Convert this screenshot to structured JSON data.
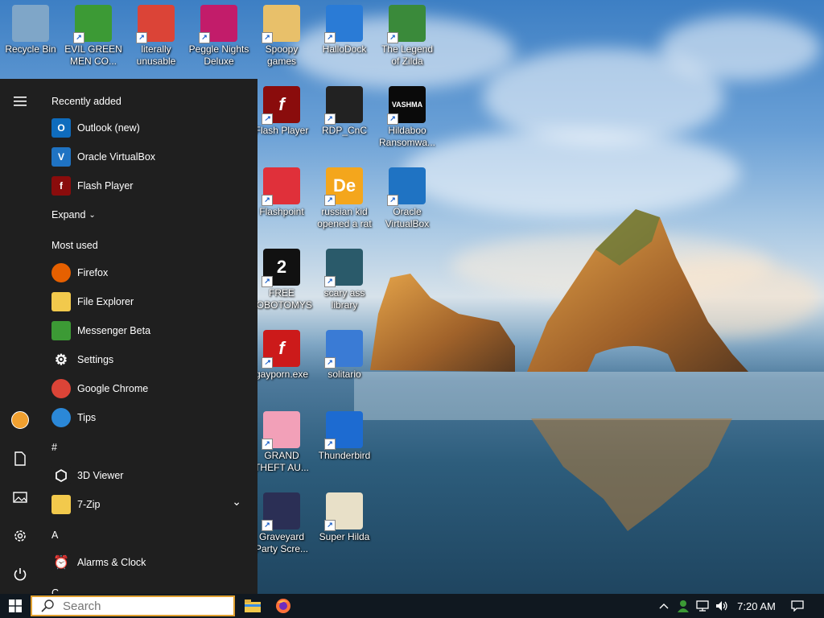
{
  "desktop": {
    "icons": [
      {
        "label": "Recycle Bin",
        "icon": "recycle-bin-icon",
        "color": "#7fa6c8"
      },
      {
        "label": "EVIL GREEN MEN CO...",
        "icon": "messenger-green-men-icon",
        "color": "#3c9a35"
      },
      {
        "label": "literally unusable",
        "icon": "chrome-icon",
        "color": "#db4437"
      },
      {
        "label": "Peggle Nights Deluxe",
        "icon": "peggle-icon",
        "color": "#c21c6a"
      },
      {
        "label": "Spoopy games",
        "icon": "folder-games-icon",
        "color": "#e8c06a"
      },
      {
        "label": "HalloDock",
        "icon": "shield-icon",
        "color": "#2a7bd6"
      },
      {
        "label": "The Legend of Zilda",
        "icon": "zilda-character-icon",
        "color": "#3a8a3a"
      },
      {
        "label": "Flash Player",
        "icon": "flash-player-icon",
        "color": "#8a0c0c",
        "glyph": "f"
      },
      {
        "label": "RDP_CnC",
        "icon": "rdp-icon",
        "color": "#222222"
      },
      {
        "label": "Hildaboo Ransomwa...",
        "icon": "vashma-icon",
        "color": "#0a0a0a",
        "glyph": "VASHMA"
      },
      {
        "label": "Flashpoint",
        "icon": "flashpoint-icon",
        "color": "#e0303a"
      },
      {
        "label": "russian kid opened a rat",
        "icon": "de-icon",
        "color": "#f4a61c",
        "glyph": "De"
      },
      {
        "label": "Oracle VirtualBox",
        "icon": "virtualbox-icon",
        "color": "#1f73c3"
      },
      {
        "label": "FREE LOBOTOMYS",
        "icon": "lobotomy-icon",
        "color": "#111111",
        "glyph": "2"
      },
      {
        "label": "scary ass library",
        "icon": "library-icon",
        "color": "#2a5a6a"
      },
      {
        "label": "gayporn.exe",
        "icon": "flash-red-icon",
        "color": "#cc1a1a",
        "glyph": "f"
      },
      {
        "label": "solitario",
        "icon": "solitario-icon",
        "color": "#3a7bd5"
      },
      {
        "label": "GRAND THEFT AU...",
        "icon": "anime-girl-icon",
        "color": "#f2a0b8"
      },
      {
        "label": "Thunderbird",
        "icon": "thunderbird-icon",
        "color": "#1d6bd1"
      },
      {
        "label": "Graveyard Party Scre...",
        "icon": "graveyard-icon",
        "color": "#2b2f55"
      },
      {
        "label": "Super Hilda",
        "icon": "super-hilda-icon",
        "color": "#e8e0c8"
      }
    ]
  },
  "start_menu": {
    "rail": {
      "hamburger_icon": "hamburger-menu-icon",
      "buttons": [
        {
          "icon": "user-avatar-icon"
        },
        {
          "icon": "documents-icon"
        },
        {
          "icon": "pictures-icon"
        },
        {
          "icon": "settings-gear-icon"
        },
        {
          "icon": "power-icon"
        }
      ]
    },
    "recently_added_header": "Recently added",
    "recently_added": [
      {
        "label": "Outlook (new)",
        "icon": "outlook-icon",
        "color": "#0f6cbd",
        "glyph": "O"
      },
      {
        "label": "Oracle VirtualBox",
        "icon": "virtualbox-icon",
        "color": "#1f73c3",
        "glyph": "V"
      },
      {
        "label": "Flash Player",
        "icon": "flash-player-icon",
        "color": "#8a0c0c",
        "glyph": "f"
      }
    ],
    "expand_label": "Expand",
    "most_used_header": "Most used",
    "most_used": [
      {
        "label": "Firefox",
        "icon": "firefox-icon",
        "color": "#e66000"
      },
      {
        "label": "File Explorer",
        "icon": "file-explorer-icon",
        "color": "#f2c94c"
      },
      {
        "label": "Messenger Beta",
        "icon": "messenger-icon",
        "color": "#3c9a35"
      },
      {
        "label": "Settings",
        "icon": "settings-gear-icon",
        "color": "#1f1f1f"
      },
      {
        "label": "Google Chrome",
        "icon": "chrome-icon",
        "color": "#db4437"
      },
      {
        "label": "Tips",
        "icon": "tips-lightbulb-icon",
        "color": "#2b88d8"
      }
    ],
    "hash_header": "#",
    "hash_apps": [
      {
        "label": "3D Viewer",
        "icon": "3d-viewer-icon",
        "color": "#1f1f1f"
      },
      {
        "label": "7-Zip",
        "icon": "folder-icon",
        "color": "#f2c94c"
      }
    ],
    "a_header": "A",
    "a_apps": [
      {
        "label": "Alarms & Clock",
        "icon": "alarm-clock-icon",
        "color": "#1f1f1f"
      }
    ],
    "c_header": "C"
  },
  "taskbar": {
    "search_placeholder": "Search",
    "pinned": [
      {
        "icon": "file-explorer-icon"
      },
      {
        "icon": "firefox-icon"
      }
    ],
    "tray": {
      "overflow_icon": "chevron-up-icon",
      "icons": [
        "messenger-tray-icon",
        "network-icon",
        "volume-icon"
      ],
      "time": "7:20 AM",
      "notification_icon": "action-center-icon"
    }
  },
  "colors": {
    "start_menu_bg": "#1f1f1f",
    "taskbar_bg": "#101820",
    "search_border": "#e0a030"
  }
}
